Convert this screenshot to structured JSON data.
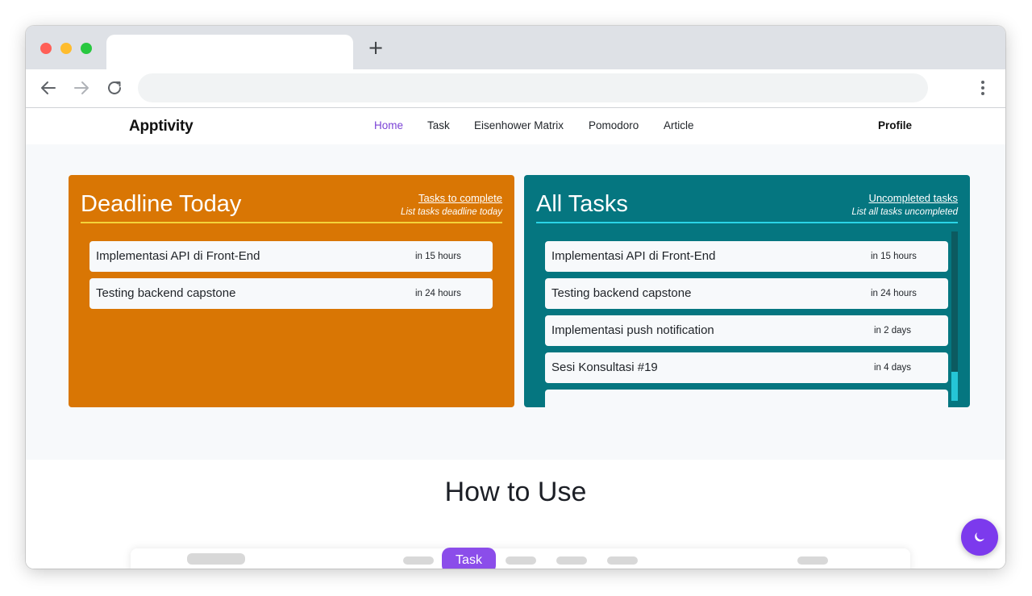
{
  "browser": {
    "new_tab_label": "+"
  },
  "site_nav": {
    "logo": "Apptivity",
    "items": [
      {
        "label": "Home",
        "active": true
      },
      {
        "label": "Task",
        "active": false
      },
      {
        "label": "Eisenhower Matrix",
        "active": false
      },
      {
        "label": "Pomodoro",
        "active": false
      },
      {
        "label": "Article",
        "active": false
      }
    ],
    "profile": "Profile"
  },
  "deadline_card": {
    "title": "Deadline Today",
    "link": "Tasks to complete",
    "subtitle": "List tasks deadline today",
    "tasks": [
      {
        "name": "Implementasi API di Front-End",
        "due": "in 15 hours"
      },
      {
        "name": "Testing backend capstone",
        "due": "in 24 hours"
      }
    ]
  },
  "all_tasks_card": {
    "title": "All Tasks",
    "link": "Uncompleted tasks",
    "subtitle": "List all tasks uncompleted",
    "tasks": [
      {
        "name": "Implementasi API di Front-End",
        "due": "in 15 hours"
      },
      {
        "name": "Testing backend capstone",
        "due": "in 24 hours"
      },
      {
        "name": "Implementasi push notification",
        "due": "in 2 days"
      },
      {
        "name": "Sesi Konsultasi #19",
        "due": "in 4 days"
      }
    ]
  },
  "how_to": {
    "title": "How to Use",
    "preview_tab_label": "Task"
  },
  "colors": {
    "accent": "#7b43d6",
    "deadline_card": "#d97604",
    "all_tasks_card": "#057680",
    "fab": "#7c3aed"
  },
  "icons": {
    "fab": "moon-icon",
    "back": "arrow-left-icon",
    "forward": "arrow-right-icon",
    "reload": "reload-icon",
    "menu": "vertical-dots-icon"
  }
}
